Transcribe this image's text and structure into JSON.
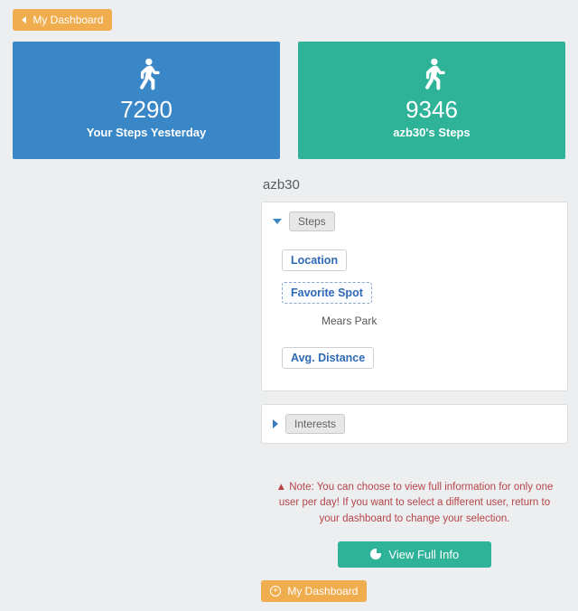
{
  "topButton": {
    "label": "My Dashboard"
  },
  "cards": {
    "left": {
      "value": "7290",
      "label": "Your Steps Yesterday"
    },
    "right": {
      "value": "9346",
      "label": "azb30's Steps"
    }
  },
  "profile": {
    "username": "azb30",
    "panels": {
      "steps": {
        "title": "Steps",
        "items": {
          "location": "Location",
          "favoriteSpot": "Favorite Spot",
          "favoriteSpotValue": "Mears Park",
          "avgDistance": "Avg. Distance"
        }
      },
      "interests": {
        "title": "Interests"
      }
    }
  },
  "note": {
    "prefix": "Note: You can choose to view full information for only one user per day! If you want to select a different user, return to your dashboard to change your selection."
  },
  "actions": {
    "viewFull": "View Full Info",
    "dashboard": "My Dashboard"
  }
}
